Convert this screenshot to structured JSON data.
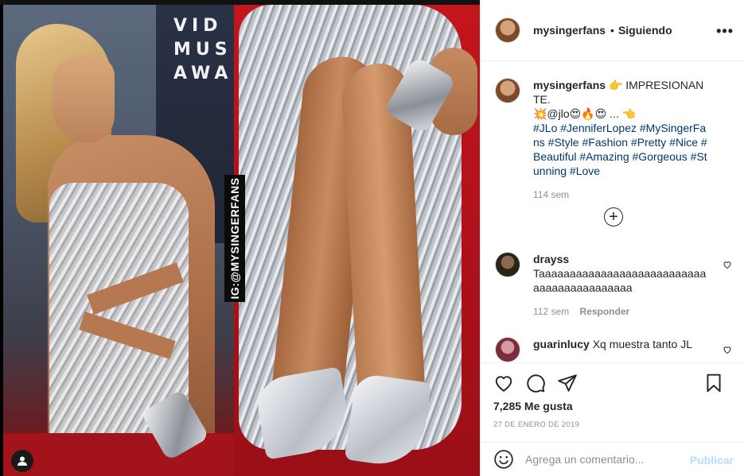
{
  "photo": {
    "backdrop_text": "VID MUS AWAR",
    "watermark": "IG:@MYSINGERFANS"
  },
  "header": {
    "username": "mysingerfans",
    "separator": "•",
    "follow_status": "Siguiendo",
    "more": "•••"
  },
  "caption": {
    "username": "mysingerfans",
    "text_lead": "👉 IMPRESIONANTE.",
    "text_line2": "💥@jlo😍🔥😍 ... 👈",
    "hashtags": "#JLo #JenniferLopez #MySingerFans #Style #Fashion #Pretty #Nice #Beautiful #Amazing #Gorgeous #Stunning #Love",
    "time": "114 sem"
  },
  "load_more": "+",
  "comments": [
    {
      "username": "drayss",
      "text": "Taaaaaaaaaaaaaaaaaaaaaaaaaaaaaaaaaaaaaaaaaaa",
      "time": "112 sem",
      "reply": "Responder"
    },
    {
      "username": "guarinlucy",
      "text": "Xq muestra tanto JL"
    }
  ],
  "actions": {
    "like_icon": "heart-icon",
    "comment_icon": "comment-icon",
    "share_icon": "paper-plane-icon",
    "save_icon": "bookmark-icon"
  },
  "likes": "7,285 Me gusta",
  "date": "27 DE ENERO DE 2019",
  "add_comment": {
    "placeholder": "Agrega un comentario...",
    "publish": "Publicar"
  },
  "colors": {
    "link": "#00376b",
    "muted": "#8e8e8e",
    "publish_disabled": "#b2dffc"
  }
}
